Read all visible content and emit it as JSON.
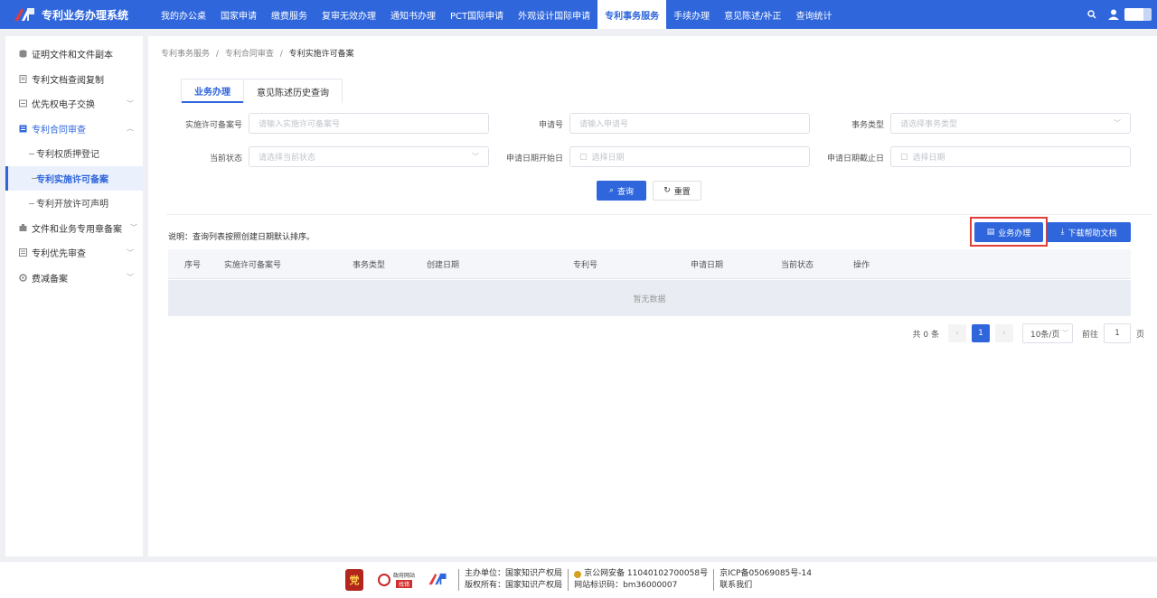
{
  "app": {
    "title": "专利业务办理系统"
  },
  "nav": {
    "items": [
      "我的办公桌",
      "国家申请",
      "缴费服务",
      "复审无效办理",
      "通知书办理",
      "PCT国际申请",
      "外观设计国际申请",
      "专利事务服务",
      "手续办理",
      "意见陈述/补正",
      "查询统计"
    ],
    "active_index": 7
  },
  "sidebar": {
    "items": [
      {
        "label": "证明文件和文件副本"
      },
      {
        "label": "专利文档查阅复制"
      },
      {
        "label": "优先权电子交换"
      },
      {
        "label": "专利合同审查"
      },
      {
        "label": "专利权质押登记"
      },
      {
        "label": "专利实施许可备案"
      },
      {
        "label": "专利开放许可声明"
      },
      {
        "label": "文件和业务专用章备案"
      },
      {
        "label": "专利优先审查"
      },
      {
        "label": "费减备案"
      }
    ]
  },
  "breadcrumb": {
    "b1": "专利事务服务",
    "sep": "/",
    "b2": "专利合同审查",
    "b3": "专利实施许可备案"
  },
  "tabs": [
    "业务办理",
    "意见陈述历史查询"
  ],
  "form": {
    "license_no_label": "实施许可备案号",
    "license_no_placeholder": "请输入实施许可备案号",
    "app_no_label": "申请号",
    "app_no_placeholder": "请输入申请号",
    "type_label": "事务类型",
    "type_placeholder": "请选择事务类型",
    "status_label": "当前状态",
    "status_placeholder": "请选择当前状态",
    "start_label": "申请日期开始日",
    "start_placeholder": "选择日期",
    "end_label": "申请日期截止日",
    "end_placeholder": "选择日期"
  },
  "buttons": {
    "query": "查询",
    "reset": "重置",
    "handle": "业务办理",
    "download": "下载帮助文档"
  },
  "note": "说明：查询列表按照创建日期默认排序。",
  "table": {
    "headers": [
      "序号",
      "实施许可备案号",
      "事务类型",
      "创建日期",
      "专利号",
      "申请日期",
      "当前状态",
      "操作"
    ],
    "empty": "暂无数据"
  },
  "pagination": {
    "total": "共 0 条",
    "page": "1",
    "page_size": "10条/页",
    "goto": "前往",
    "goto_value": "1",
    "page_unit": "页"
  },
  "footer": {
    "edu_name": "政府网站",
    "edu_tag": "找错",
    "host_label": "主办单位：国家知识产权局",
    "rights_label": "版权所有：国家知识产权局",
    "police": "京公网安备 11040102700058号",
    "site_code": "网站标识码：bm36000007",
    "icp": "京ICP备05069085号-14",
    "contact": "联系我们"
  },
  "colors": {
    "primary": "#2f66dc",
    "highlight": "#e0403a"
  }
}
